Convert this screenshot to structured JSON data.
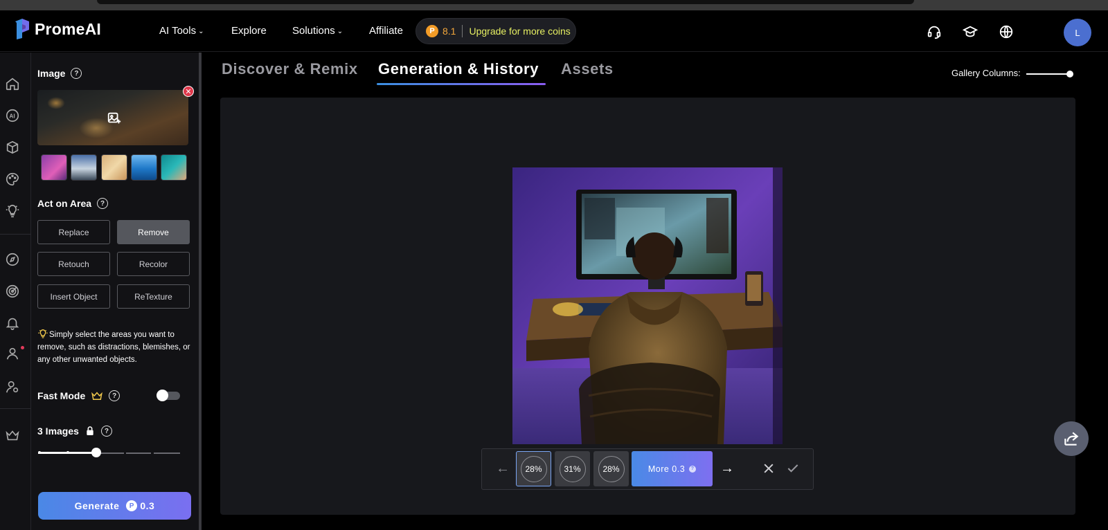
{
  "brand": {
    "name": "PromeAI",
    "logo_icon": "promeai-logo-icon"
  },
  "nav": {
    "items": [
      {
        "label": "AI Tools",
        "has_dropdown": true
      },
      {
        "label": "Explore",
        "has_dropdown": false
      },
      {
        "label": "Solutions",
        "has_dropdown": true
      },
      {
        "label": "Affiliate",
        "has_dropdown": false
      }
    ],
    "coins": {
      "value": "8.1",
      "upgrade_label": "Upgrade for more coins"
    },
    "icons": [
      "headset-icon",
      "graduation-cap-icon",
      "globe-icon"
    ],
    "avatar_initial": "L"
  },
  "rail": {
    "icons": [
      "home-icon",
      "ai-icon",
      "cube-icon",
      "palette-icon",
      "lightbulb-icon",
      "compass-icon",
      "target-icon",
      "bell-icon",
      "user-icon",
      "user-settings-icon",
      "crown-icon"
    ]
  },
  "panel": {
    "image_label": "Image",
    "act_label": "Act on Area",
    "options": [
      "Replace",
      "Remove",
      "Retouch",
      "Recolor",
      "Insert Object",
      "ReTexture"
    ],
    "selected_option": "Remove",
    "tip": "Simply select the areas you want to remove, such as distractions, blemishes, or any other unwanted objects.",
    "fast_mode_label": "Fast Mode",
    "fast_mode_on": false,
    "images_label": "3 Images",
    "images_count": 3,
    "generate_label": "Generate",
    "generate_cost": "0.3"
  },
  "main": {
    "tabs": [
      "Discover & Remix",
      "Generation & History",
      "Assets"
    ],
    "active_tab": "Generation & History",
    "gallery_columns_label": "Gallery Columns:",
    "result": {
      "variants": [
        "28%",
        "31%",
        "28%"
      ],
      "more_label": "More 0.3"
    }
  },
  "colors": {
    "accent_gradient_start": "#4a88e6",
    "accent_gradient_end": "#7a6ff0",
    "coin": "#f39c27",
    "upgrade_text": "#e6ef62",
    "close_badge": "#e0384b"
  }
}
